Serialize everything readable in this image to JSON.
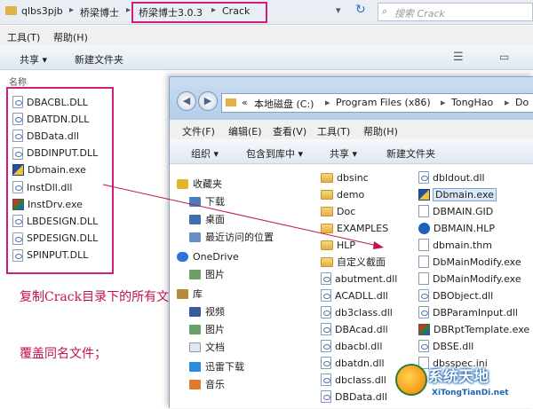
{
  "back_window": {
    "breadcrumbs": [
      "qlbs3pjb",
      "桥梁博士",
      "桥梁博士3.0.3",
      "Crack"
    ],
    "search_placeholder": "搜索 Crack",
    "menu": [
      "工具(T)",
      "帮助(H)"
    ],
    "toolbar": [
      "共享 ▾",
      "新建文件夹"
    ],
    "column_header": "名称",
    "files": [
      {
        "name": "DBACBL.DLL",
        "icon": "dll"
      },
      {
        "name": "DBATDN.DLL",
        "icon": "dll"
      },
      {
        "name": "DBData.dll",
        "icon": "dll"
      },
      {
        "name": "DBDINPUT.DLL",
        "icon": "dll"
      },
      {
        "name": "Dbmain.exe",
        "icon": "exe"
      },
      {
        "name": "InstDll.dll",
        "icon": "dll"
      },
      {
        "name": "InstDrv.exe",
        "icon": "exe2"
      },
      {
        "name": "LBDESIGN.DLL",
        "icon": "dll"
      },
      {
        "name": "SPDESIGN.DLL",
        "icon": "dll"
      },
      {
        "name": "SPINPUT.DLL",
        "icon": "dll"
      }
    ]
  },
  "note": {
    "line1": "复制Crack目录下的所有文件到安装目录，",
    "line2": "覆盖同名文件；"
  },
  "front_window": {
    "address": [
      "«",
      "本地磁盘 (C:)",
      "Program Files (x86)",
      "TongHao",
      "Do"
    ],
    "menu": [
      "文件(F)",
      "编辑(E)",
      "查看(V)",
      "工具(T)",
      "帮助(H)"
    ],
    "toolbar": [
      "组织 ▾",
      "包含到库中 ▾",
      "共享 ▾",
      "新建文件夹"
    ],
    "sidebar": [
      {
        "label": "收藏夹",
        "icon": "star"
      },
      {
        "label": "下载",
        "icon": "dl"
      },
      {
        "label": "桌面",
        "icon": "desk"
      },
      {
        "label": "最近访问的位置",
        "icon": "recent"
      },
      {
        "label": "OneDrive",
        "icon": "od"
      },
      {
        "label": "图片",
        "icon": "pic"
      },
      {
        "label": "库",
        "icon": "lib"
      },
      {
        "label": "视频",
        "icon": "vid"
      },
      {
        "label": "图片",
        "icon": "pic"
      },
      {
        "label": "文档",
        "icon": "doc"
      },
      {
        "label": "迅雷下载",
        "icon": "thunder"
      },
      {
        "label": "音乐",
        "icon": "music"
      }
    ],
    "col1": [
      {
        "name": "dbsinc",
        "icon": "folder"
      },
      {
        "name": "demo",
        "icon": "folder"
      },
      {
        "name": "Doc",
        "icon": "folder"
      },
      {
        "name": "EXAMPLES",
        "icon": "folder"
      },
      {
        "name": "HLP",
        "icon": "folder"
      },
      {
        "name": "自定义截面",
        "icon": "folder"
      },
      {
        "name": "abutment.dll",
        "icon": "dll"
      },
      {
        "name": "ACADLL.dll",
        "icon": "dll"
      },
      {
        "name": "db3class.dll",
        "icon": "dll"
      },
      {
        "name": "DBAcad.dll",
        "icon": "dll"
      },
      {
        "name": "dbacbl.dll",
        "icon": "dll"
      },
      {
        "name": "dbatdn.dll",
        "icon": "dll"
      },
      {
        "name": "dbclass.dll",
        "icon": "dll"
      },
      {
        "name": "DBData.dll",
        "icon": "dll"
      }
    ],
    "col2": [
      {
        "name": "dbldout.dll",
        "icon": "dll"
      },
      {
        "name": "Dbmain.exe",
        "icon": "exe"
      },
      {
        "name": "DBMAIN.GID",
        "icon": "generic"
      },
      {
        "name": "DBMAIN.HLP",
        "icon": "help"
      },
      {
        "name": "dbmain.thm",
        "icon": "generic"
      },
      {
        "name": "DbMainModify.exe",
        "icon": "generic"
      },
      {
        "name": "DbMainModify.exe",
        "icon": "generic"
      },
      {
        "name": "DBObject.dll",
        "icon": "dll"
      },
      {
        "name": "DBParamInput.dll",
        "icon": "dll"
      },
      {
        "name": "DBRptTemplate.exe",
        "icon": "exe2"
      },
      {
        "name": "DBSE.dll",
        "icon": "dll"
      },
      {
        "name": "dbsspec.ini",
        "icon": "generic"
      }
    ]
  },
  "watermark": {
    "title": "系统天地",
    "subtitle": "XiTongTianDi.net"
  },
  "colors": {
    "highlight_box": "#d01f7b",
    "note_text": "#c0124f"
  }
}
